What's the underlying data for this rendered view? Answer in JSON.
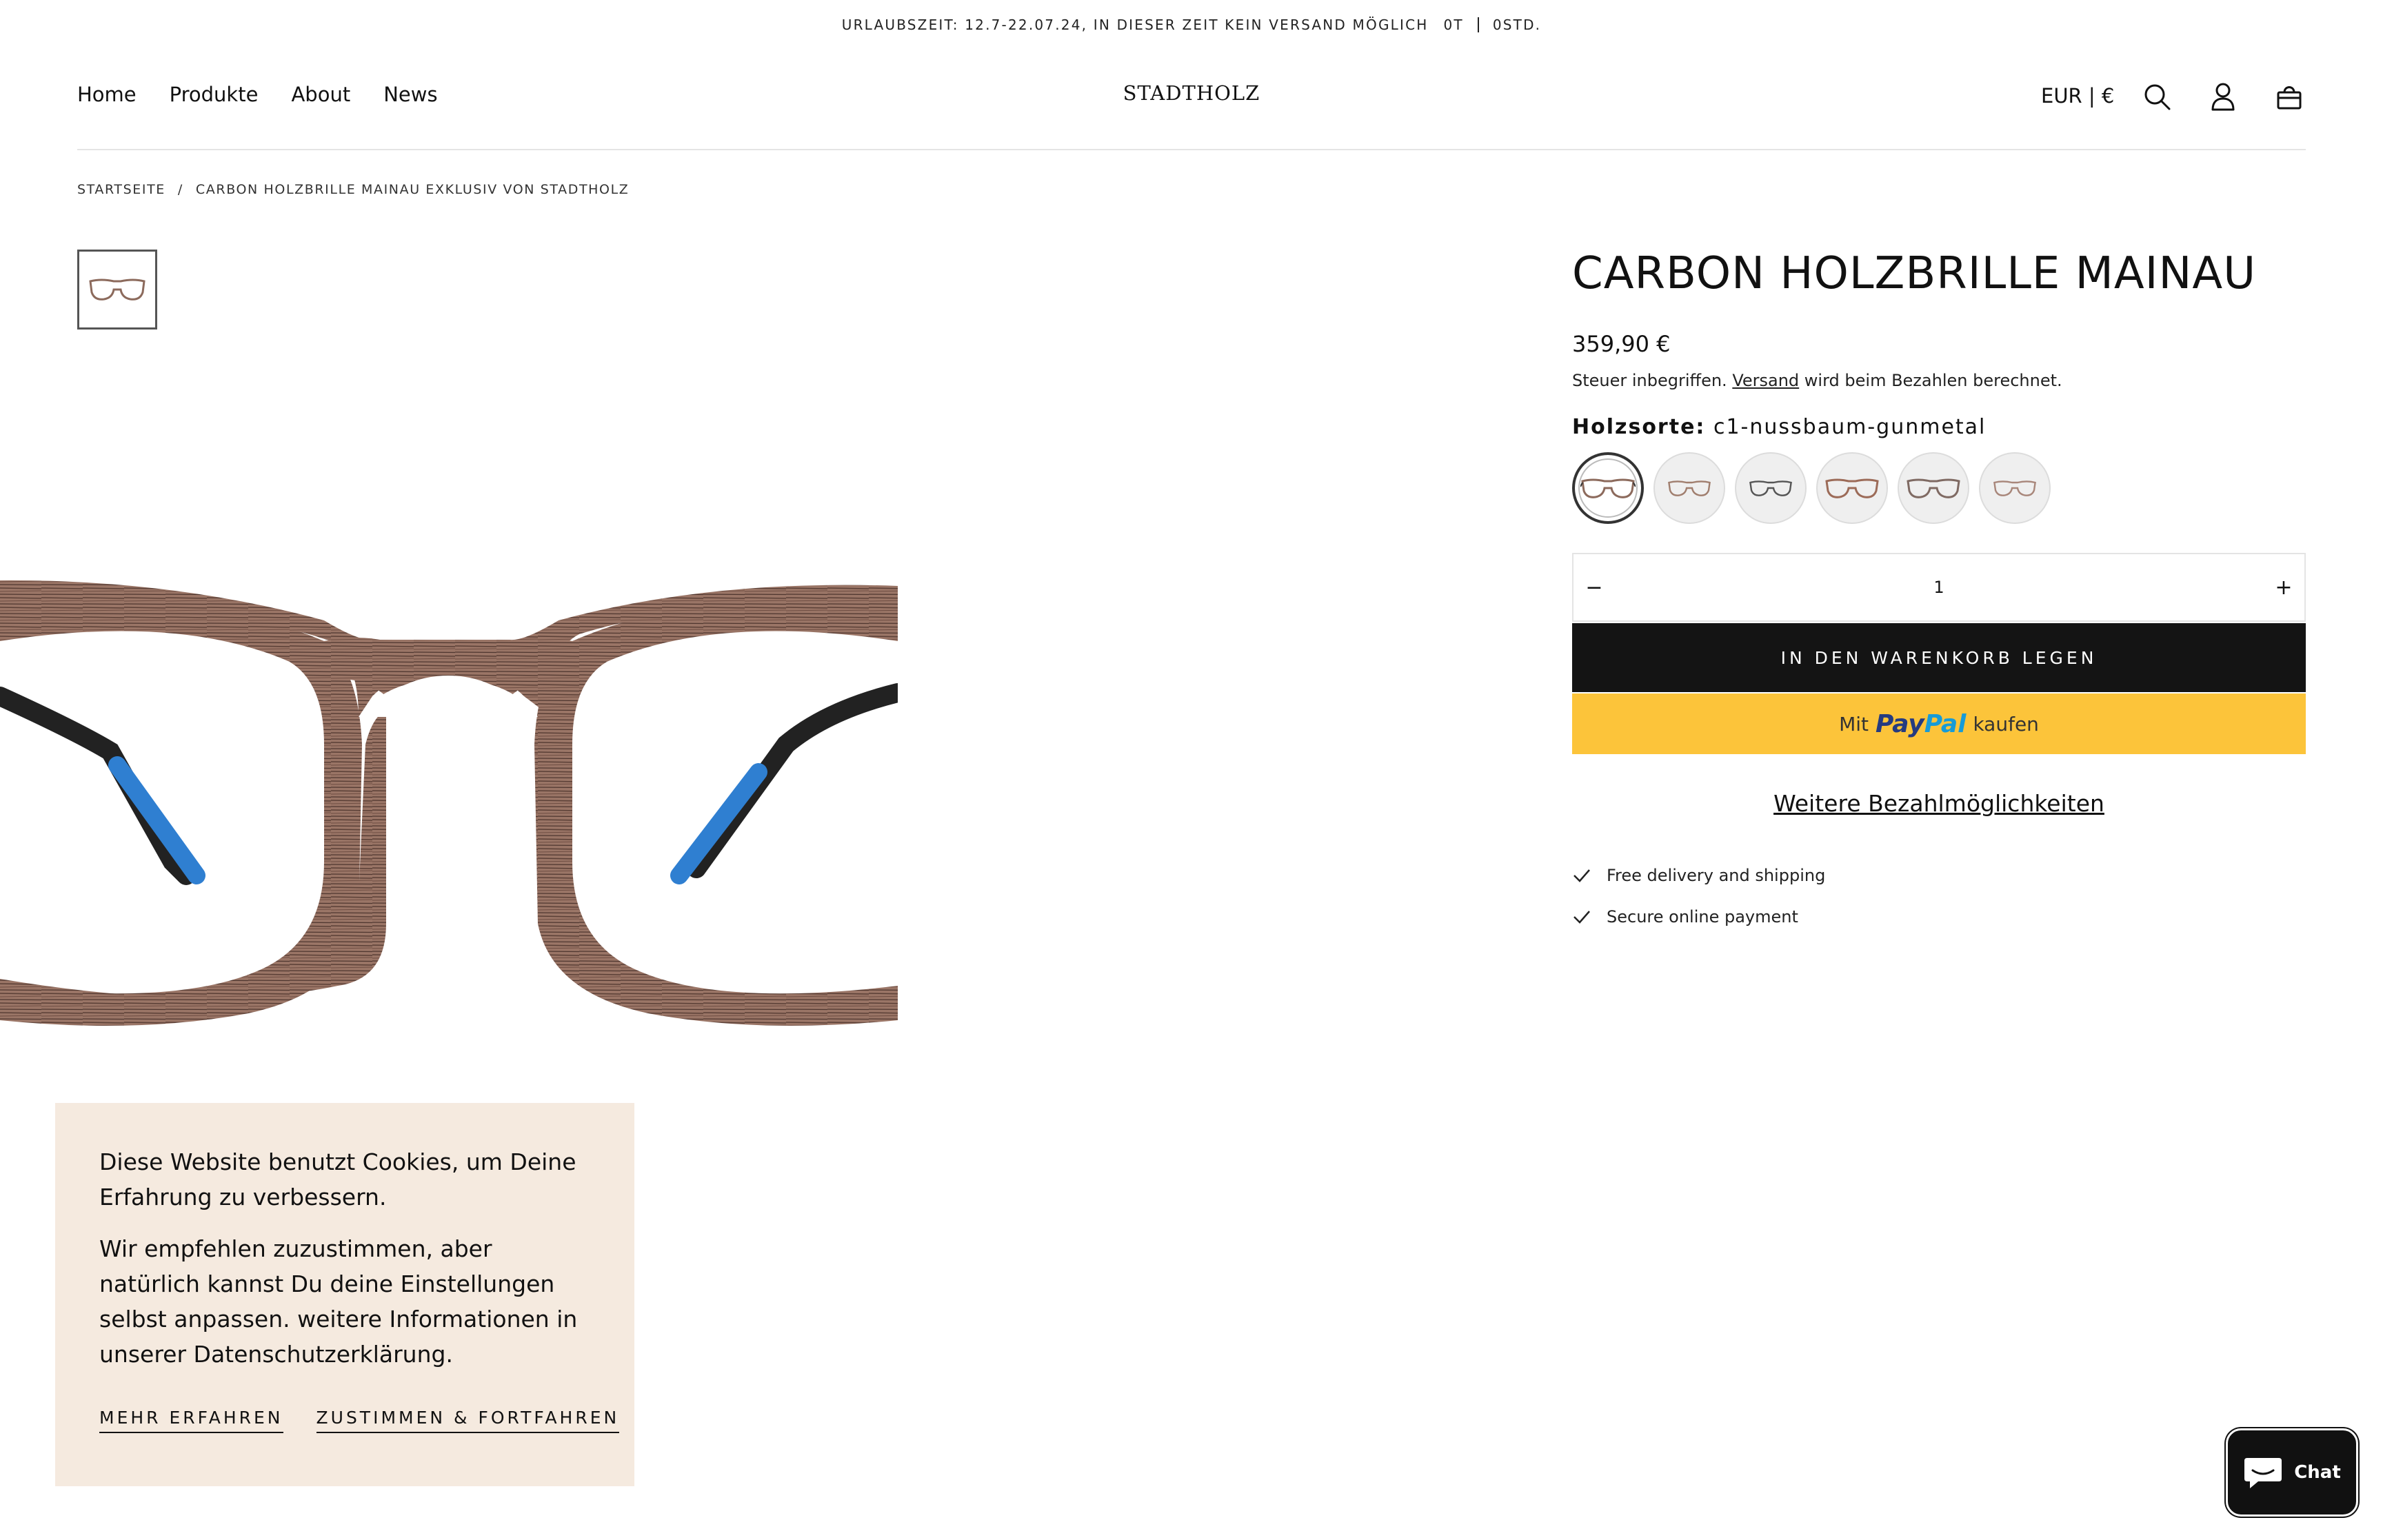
{
  "announcement": {
    "text": "URLAUBSZEIT: 12.7-22.07.24, IN DIESER ZEIT KEIN VERSAND MÖGLICH",
    "countdown_days": "0T",
    "countdown_hours": "0STD."
  },
  "header": {
    "nav": [
      "Home",
      "Produkte",
      "About",
      "News"
    ],
    "logo": "STADTHOLZ",
    "currency": "EUR | €",
    "icons": [
      "search-icon",
      "account-icon",
      "cart-icon"
    ]
  },
  "breadcrumb": {
    "home": "STARTSEITE",
    "separator": "/",
    "current": "CARBON HOLZBRILLE MAINAU EXKLUSIV VON STADTHOLZ"
  },
  "product": {
    "title": "CARBON HOLZBRILLE MAINAU",
    "price": "359,90 €",
    "tax_prefix": "Steuer inbegriffen.",
    "tax_link": "Versand",
    "tax_suffix": "wird beim Bezahlen berechnet.",
    "variant_label": "Holzsorte:",
    "variant_value": "c1-nussbaum-gunmetal",
    "swatch_count": 6,
    "quantity": "1",
    "qty_minus": "−",
    "qty_plus": "+",
    "add_to_cart": "IN DEN WARENKORB LEGEN",
    "paypal_prefix": "Mit",
    "paypal_brand_1": "Pay",
    "paypal_brand_2": "Pal",
    "paypal_suffix": "kaufen",
    "more_payment": "Weitere Bezahlmöglichkeiten",
    "features": [
      "Free delivery and shipping",
      "Secure online payment"
    ]
  },
  "cookie": {
    "text1": "Diese Website benutzt Cookies, um Deine Erfahrung zu verbessern.",
    "text2": "Wir empfehlen zuzustimmen, aber natürlich kannst Du deine Einstellungen selbst anpassen. weitere Informationen in unserer Datenschutzerklärung.",
    "learn_more": "MEHR ERFAHREN",
    "accept": "ZUSTIMMEN & FORTFAHREN"
  },
  "chat": {
    "label": "Chat"
  },
  "colors": {
    "wood": "#8c6a5c",
    "temple_blue": "#2f7fd1",
    "button_dark": "#141414",
    "paypal_yellow": "#fcc43a",
    "cookie_bg": "#f5eadf"
  }
}
